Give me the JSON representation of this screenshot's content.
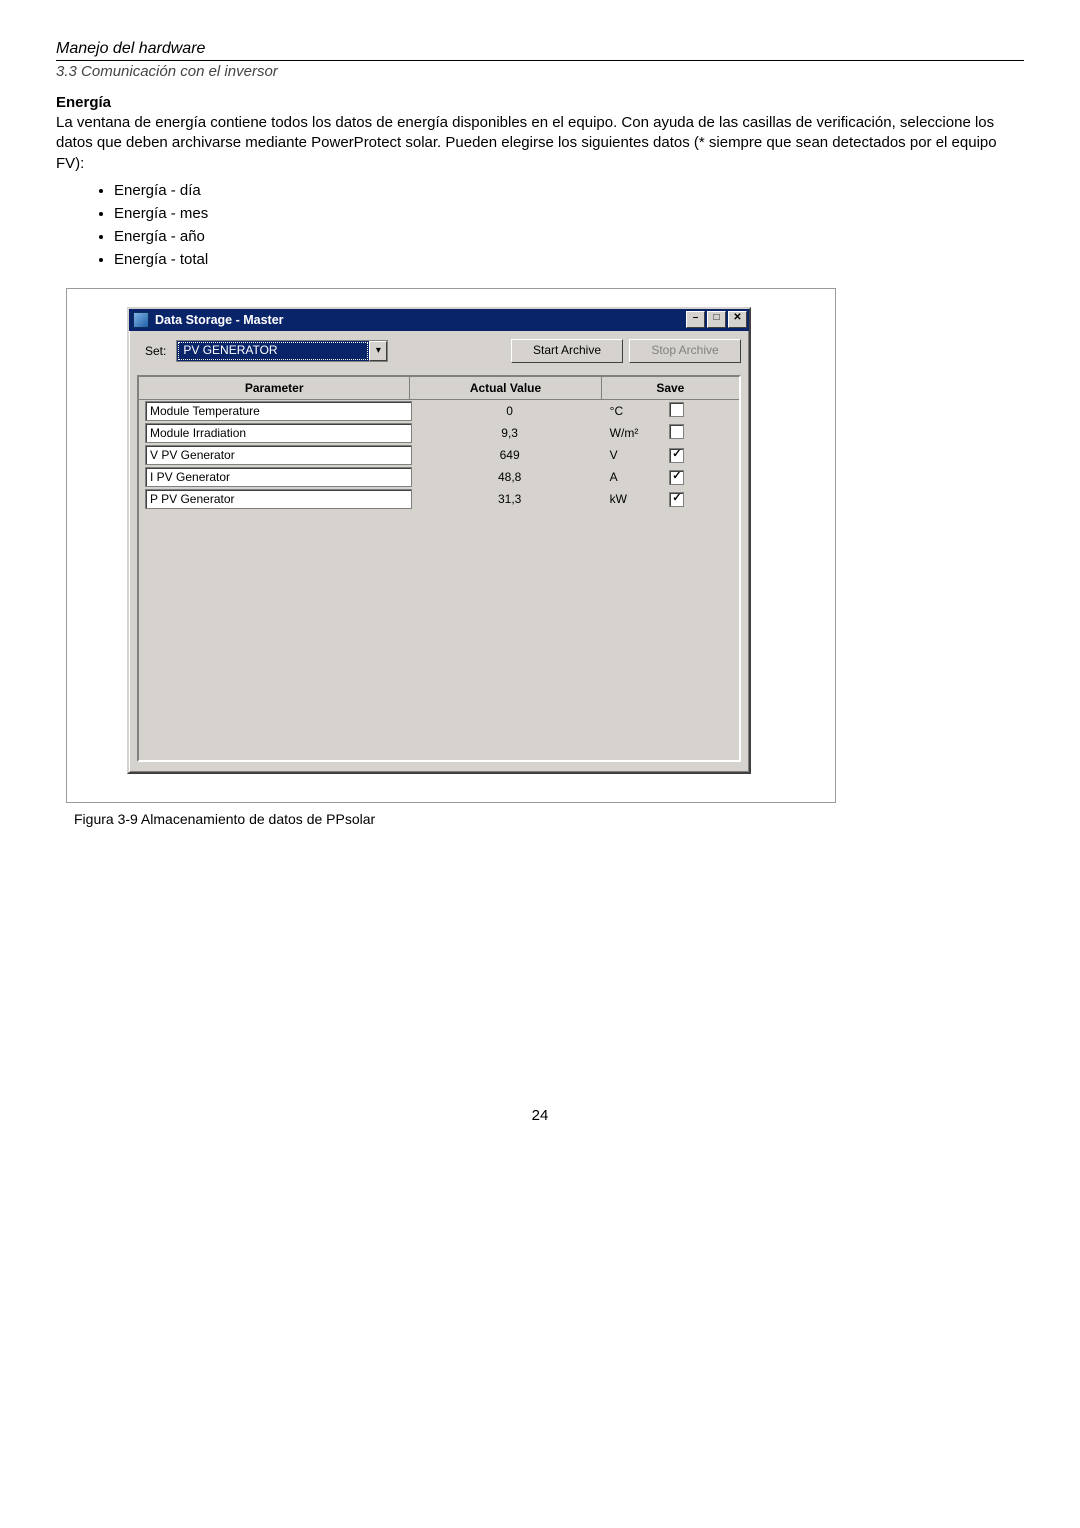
{
  "doc": {
    "chapter": "Manejo del hardware",
    "section": "3.3 Comunicación con el inversor",
    "heading": "Energía",
    "paragraph": "La ventana de energía contiene todos los datos de energía disponibles en el equipo. Con ayuda de las casillas de verificación, seleccione los datos que deben archivarse mediante PowerProtect solar. Pueden elegirse los siguientes datos (* siempre que sean detectados por el equipo FV):",
    "bullets": [
      "Energía - día",
      "Energía - mes",
      "Energía - año",
      "Energía - total"
    ],
    "caption": "Figura 3-9 Almacenamiento de datos de PPsolar",
    "page": "24"
  },
  "win": {
    "title": "Data Storage - Master",
    "set_label": "Set:",
    "set_value": "PV GENERATOR",
    "start_btn": "Start Archive",
    "stop_btn": "Stop Archive",
    "headers": {
      "param": "Parameter",
      "value": "Actual Value",
      "save": "Save"
    },
    "rows": [
      {
        "param": "Module Temperature",
        "value": "0",
        "unit": "°C",
        "checked": false
      },
      {
        "param": "Module Irradiation",
        "value": "9,3",
        "unit": "W/m²",
        "checked": false
      },
      {
        "param": "V PV Generator",
        "value": "649",
        "unit": "V",
        "checked": true
      },
      {
        "param": "I PV Generator",
        "value": "48,8",
        "unit": "A",
        "checked": true
      },
      {
        "param": "P PV Generator",
        "value": "31,3",
        "unit": "kW",
        "checked": true
      }
    ]
  }
}
